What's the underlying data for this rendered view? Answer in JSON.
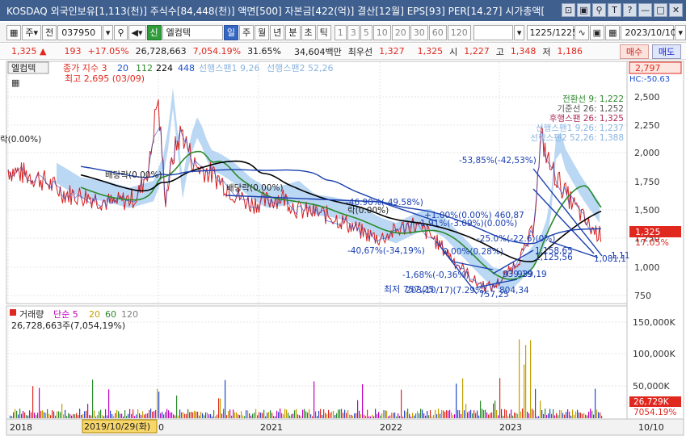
{
  "titlebar": {
    "text": "KOSDAQ 외국인보유[1,113(천)] 주식수[84,448(천)] 액면[500] 자본금[422(억)] 결산[12월] EPS[93] PER[14.27] 시가총액[",
    "icons": [
      "layout-icon",
      "save-icon",
      "pin-icon",
      "text-icon",
      "help-icon",
      "minimize-icon",
      "restore-icon",
      "close-icon"
    ],
    "icon_glyphs": [
      "⊡",
      "▣",
      "⚲",
      "T",
      "?",
      "—",
      "□",
      "✕"
    ]
  },
  "toolbar": {
    "market_label": "주",
    "prev_label": "전",
    "code": "037950",
    "stock_name": "엘컴텍",
    "prefix_badge": "신",
    "periods": [
      "일",
      "주",
      "월",
      "년",
      "분",
      "초",
      "틱"
    ],
    "selected_period": "일",
    "intervals": [
      "1",
      "3",
      "5",
      "10",
      "20",
      "30",
      "60",
      "120"
    ],
    "count_value": "1225",
    "count_total": "/1225",
    "date_value": "2023/10/10"
  },
  "quote": {
    "price": "1,325",
    "change": "193",
    "change_pct": "+17.05%",
    "volume": "26,728,663",
    "volume_ratio": "7,054.19%",
    "rate": "31.65%",
    "amount": "34,604백만",
    "priority_label": "최우선",
    "ask": "1,327",
    "bid": "1,325",
    "open_label": "시",
    "open": "1,227",
    "high_label": "고",
    "high": "1,348",
    "low_label": "저",
    "low": "1,186",
    "buy_label": "매수",
    "sell_label": "매도"
  },
  "price_panel": {
    "stock_label": "엘컴텍",
    "legend_items": [
      {
        "text": "종가 지수 3",
        "color": "#e0281e"
      },
      {
        "text": "20",
        "color": "#1a4fd0"
      },
      {
        "text": "112",
        "color": "#2b8a2b"
      },
      {
        "text": "224",
        "color": "#000000"
      },
      {
        "text": "448",
        "color": "#1a4fd0"
      },
      {
        "text": "선행스팬1 9,26",
        "color": "#8ab4e0"
      },
      {
        "text": "선행스팬2 52,26",
        "color": "#8ab4e0"
      }
    ],
    "high_note": "최고 2,695 (03/09)",
    "low_note": "최저 757,25",
    "y_ticks": [
      "2,500",
      "2,250",
      "2,000",
      "1,750",
      "1,500",
      "1,250",
      "1,000",
      "750"
    ],
    "right_top_value": "2,797",
    "right_hc": "HC:-50.63",
    "price_tag": "1,325",
    "pct_tag": "17.05%",
    "ichimoku": [
      {
        "text": "전환선 9: 1,222",
        "color": "#2b8a2b"
      },
      {
        "text": "기준선 26: 1,252",
        "color": "#555555"
      },
      {
        "text": "후행스팬 26: 1,325",
        "color": "#b02b5a"
      },
      {
        "text": "선행스팬1 9,26: 1,237",
        "color": "#8ab4e0"
      },
      {
        "text": "선행스팬2 52,26: 1,388",
        "color": "#8ab4e0"
      }
    ],
    "annotations": [
      {
        "text": "락(0.00%)",
        "color": "#222222"
      },
      {
        "text": "배당락(0.00%)",
        "color": "#222222"
      },
      {
        "text": "배당락(0.00%)",
        "color": "#222222"
      },
      {
        "text": "-46.90%(-49.58%)",
        "color": "#1a3fb0"
      },
      {
        "text": "락(0.00%)",
        "color": "#222222"
      },
      {
        "text": "+1.00%(0.00%) 460,87",
        "color": "#1a3fb0"
      },
      {
        "text": "1.91%(-3.09%)(0.00%)",
        "color": "#1a3fb0"
      },
      {
        "text": "-25.0%(-22.6)(0%)",
        "color": "#1a3fb0"
      },
      {
        "text": "-53,85%(-42,53%)",
        "color": "#1a3fb0"
      },
      {
        "text": "-40,67%(-34,19%)",
        "color": "#1a3fb0"
      },
      {
        "text": "0.00%(0.28%)",
        "color": "#1a3fb0"
      },
      {
        "text": "1,158,65",
        "color": "#1a3fb0"
      },
      {
        "text": "1,125,56",
        "color": "#1a3fb0"
      },
      {
        "text": "-1,68%(-0,36%)",
        "color": "#1a3fb0"
      },
      {
        "text": "939,19",
        "color": "#1a3fb0"
      },
      {
        "text": "939,19",
        "color": "#1a3fb0"
      },
      {
        "text": "804,34",
        "color": "#1a3fb0"
      },
      {
        "text": "757,25",
        "color": "#1a3fb0"
      },
      {
        "text": "203(10/17)(7.29%)",
        "color": "#1a3fb0"
      },
      {
        "text": "1,081,1",
        "color": "#1a3fb0"
      },
      {
        "text": "1,11",
        "color": "#1a3fb0"
      }
    ]
  },
  "volume_panel": {
    "legend_items": [
      {
        "text": "거래량",
        "color": "#222222"
      },
      {
        "text": "단순 5",
        "color": "#c000c0"
      },
      {
        "text": "20",
        "color": "#c0a000"
      },
      {
        "text": "60",
        "color": "#2b8a2b"
      },
      {
        "text": "120",
        "color": "#808080"
      }
    ],
    "volume_text": "26,728,663주(7,054,19%)",
    "y_ticks": [
      "150,000K",
      "100,000K",
      "50,000K"
    ],
    "vol_tag": "26,729K",
    "pct_tag": "7054.19%"
  },
  "xaxis": {
    "labels": [
      "2018",
      "0",
      "2021",
      "2022",
      "2023"
    ],
    "cursor_date": "2019/10/29(화)",
    "right_label": "10/10"
  }
}
